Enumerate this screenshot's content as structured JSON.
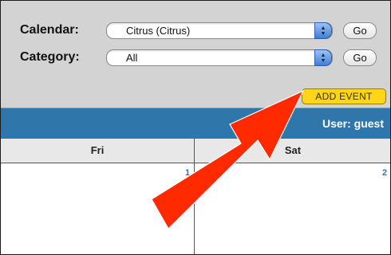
{
  "calendar": {
    "label": "Calendar:",
    "selected": "Citrus (Citrus)",
    "go_label": "Go"
  },
  "category": {
    "label": "Category:",
    "selected": "All",
    "go_label": "Go"
  },
  "add_event_label": "ADD EVENT",
  "user_text": "User: guest",
  "days": {
    "fri": "Fri",
    "sat": "Sat",
    "fri_num": "1",
    "sat_num": "2"
  },
  "colors": {
    "header_bar": "#2f77ab",
    "add_button": "#ffd51a",
    "arrow": "#ff2200"
  },
  "icons": {
    "select_arrows": "up-down-arrows-icon",
    "pointer": "annotation-arrow"
  }
}
